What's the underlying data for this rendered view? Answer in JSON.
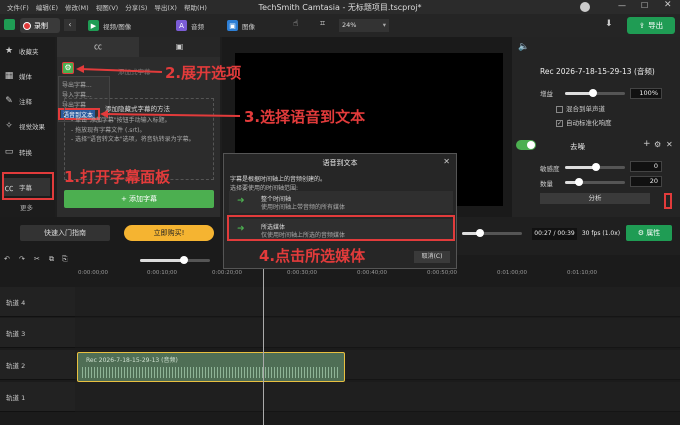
{
  "app": {
    "title": "TechSmith Camtasia - 无标题项目.tscproj*"
  },
  "menu": [
    "文件(F)",
    "编辑(E)",
    "修改(M)",
    "视图(V)",
    "分享(S)",
    "导出(X)",
    "帮助(H)"
  ],
  "toolbar": {
    "record_label": "录制",
    "tab_video": "视频/图像",
    "tab_audio": "音频",
    "tab_image": "图像",
    "zoom": "24%",
    "export_label": "导出"
  },
  "sidebar": {
    "items": [
      "收藏夹",
      "媒体",
      "注释",
      "视觉效果",
      "转换",
      "字幕"
    ],
    "more": "更多"
  },
  "captions": {
    "menu_items": [
      "导出字幕...",
      "导入字幕...",
      "导出字幕",
      "语音到文本"
    ],
    "menu_visible": [
      "导出字幕...",
      "导入字幕...",
      "导出字幕"
    ],
    "selected_item": "语音到文本",
    "header_dim": "添加式字幕",
    "help_title": "添加隐藏式字幕的方法",
    "help_lines": [
      "- 单击\"添加字幕\"按钮手动输入标题。",
      "- 拖放现有字幕文件 (.srt)。",
      "- 选择\"语音转文本\"选项，将音轨转录为字幕。"
    ],
    "add_button": "+ 添加字幕"
  },
  "promo": {
    "quickstart": "快速入门指南",
    "buy": "立即购买!"
  },
  "props": {
    "clip_name": "Rec 2026-7-18-15-29-13 (音频)",
    "gain_label": "增益",
    "gain_value": "100%",
    "mix_mono": "混合到单声道",
    "auto_normalize": "自动标准化响度",
    "denoise_title": "去噪",
    "sensitivity_label": "敏感度",
    "sensitivity_value": "0",
    "amount_label": "数量",
    "amount_value": "20",
    "analyze": "分析",
    "attributes": "属性"
  },
  "playback": {
    "time": "00:27 / 00:39",
    "fps": "30 fps (1.0x)"
  },
  "dialog": {
    "title": "语音到文本",
    "desc1": "字幕是根据时间轴上的音频创建的。",
    "desc2": "选择要使用的时间轴范围:",
    "opt1_title": "整个时间轴",
    "opt1_desc": "使用时间轴上带音频的所有媒体",
    "opt2_title": "所选媒体",
    "opt2_desc": "仅使用时间轴上所选的音频媒体",
    "cancel": "取消(C)"
  },
  "annotations": [
    "2.展开选项",
    "3.选择语音到文本",
    "1.打开字幕面板",
    "4.点击所选媒体"
  ],
  "timeline": {
    "ruler": [
      "0:00:00;00",
      "0:00:10;00",
      "0:00:20;00",
      "0:00:30;00",
      "0:00:40;00",
      "0:00:50;00",
      "0:01:00;00",
      "0:01:10;00"
    ],
    "tracks": [
      "轨道 4",
      "轨道 3",
      "轨道 2",
      "轨道 1"
    ],
    "clip_label": "Rec 2026-7-18-15-29-13 (音频)"
  },
  "colors": {
    "accent": "#1f9c54",
    "annotation": "#e23b3b",
    "promo": "#f5b431"
  }
}
